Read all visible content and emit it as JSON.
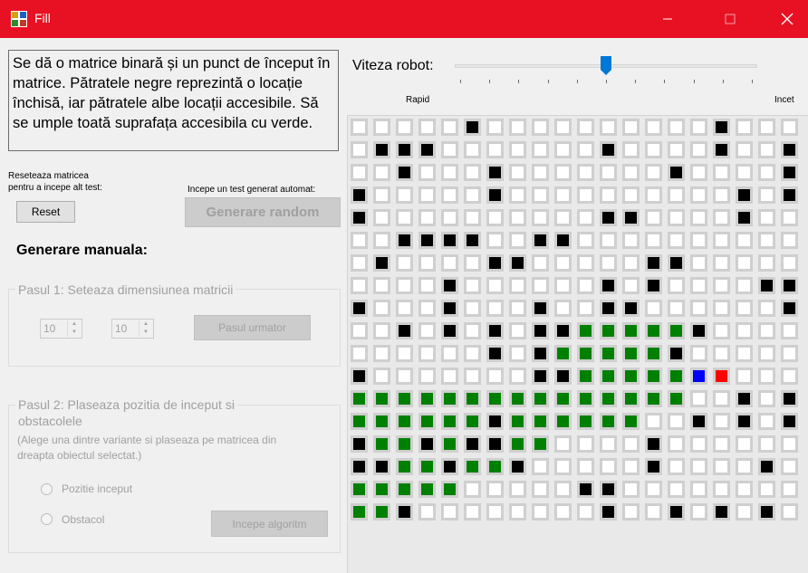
{
  "window": {
    "title": "Fill",
    "minimize_icon": "minimize-icon",
    "maximize_icon": "maximize-icon",
    "close_icon": "close-icon"
  },
  "description": "Se dă o matrice binară și un punct de început în matrice. Pătratele negre reprezintă o locație închisă, iar pătratele albe locații accesibile. Să se umple toată suprafața accesibila cu verde.",
  "reset": {
    "hint_line1": "Reseteaza matricea",
    "hint_line2": "pentru a incepe alt test:",
    "label": "Reset"
  },
  "random": {
    "hint": "Incepe un test generat automat:",
    "label": "Generare random"
  },
  "manual": {
    "heading": "Generare manuala:",
    "step1": {
      "legend": "Pasul 1: Seteaza dimensiunea matricii",
      "rows": "10",
      "cols": "10",
      "next_label": "Pasul urmator"
    },
    "step2": {
      "legend_line1": "Pasul 2: Plaseaza pozitia de inceput si",
      "legend_line2": "obstacolele",
      "hint_line1": "(Alege una dintre variante si plaseaza pe matricea din",
      "hint_line2": "dreapta obiectul selectat.)",
      "option_start": "Pozitie inceput",
      "option_obstacle": "Obstacol",
      "start_label": "Incepe algoritm"
    }
  },
  "speed": {
    "label": "Viteza robot:",
    "min_label": "Rapid",
    "max_label": "Incet",
    "value_fraction": 0.5,
    "tick_count": 10
  },
  "colors": {
    "titlebar": "#e81123",
    "empty": "#ffffff",
    "wall": "#000000",
    "filled": "#008000",
    "robot": "#0000ff",
    "current": "#ff0000",
    "cell_border": "#cfcfcf"
  },
  "matrix": {
    "legend": {
      ".": "empty",
      "#": "wall",
      "G": "filled",
      "B": "robot",
      "R": "current"
    },
    "rows": [
      ".....#..........#...",
      ".###.......#....#..#",
      "..#...#.......#....#",
      "#.....#..........#.#",
      "#..........##....#..",
      "..####..##..........",
      ".#....##.....##.....",
      "....#......#.#....##",
      "#...#...#..##......#",
      "..#.#.#.##GGGGG#....",
      "......#.#GGGGG#.....",
      "#.......##GGGGGBR...",
      "GGGGGGGGGGGGGGG..#.#",
      "GGGGGG#GGGGGG..#.#.#",
      "#GG#G##GG....#......",
      "##GG#GG#.....#....#.",
      "GGGGG.....##........",
      "GG#........#..#.#.#."
    ]
  }
}
